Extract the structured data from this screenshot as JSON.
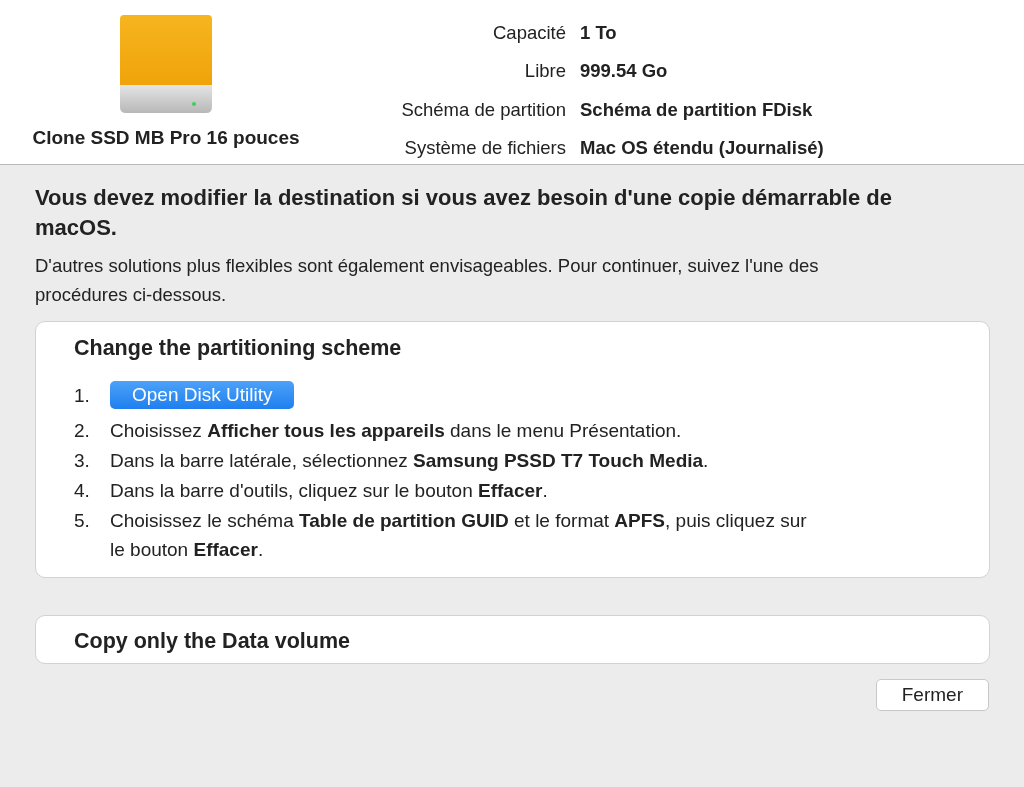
{
  "drive": {
    "name": "Clone SSD MB Pro 16 pouces"
  },
  "info": [
    {
      "label": "Capacité",
      "value": "1 To"
    },
    {
      "label": "Libre",
      "value": "999.54 Go"
    },
    {
      "label": "Schéma de partition",
      "value": "Schéma de partition FDisk"
    },
    {
      "label": "Système de fichiers",
      "value": "Mac OS étendu (Journalisé)"
    }
  ],
  "warning": {
    "title": "Vous devez modifier la destination si vous avez besoin d'une copie démarrable de macOS.",
    "text": "D'autres solutions plus flexibles sont également envisageables. Pour continuer, suivez l'une des procédures ci-dessous."
  },
  "sections": [
    {
      "title": "Change the partitioning scheme",
      "steps": [
        {
          "number": "1.",
          "kind": "button",
          "text": "Open Disk Utility"
        },
        {
          "number": "2.",
          "kind": "text",
          "text": "Choisissez **Afficher tous les appareils** dans le menu Présentation."
        },
        {
          "number": "3.",
          "kind": "text",
          "text": "Dans la barre latérale, sélectionnez **Samsung PSSD T7 Touch Media**."
        },
        {
          "number": "4.",
          "kind": "text",
          "text": "Dans la barre d'outils, cliquez sur le bouton **Effacer**."
        },
        {
          "number": "5.",
          "kind": "text",
          "text": "Choisissez le schéma **Table de partition GUID** et le format **APFS**, puis cliquez sur le bouton **Effacer**."
        }
      ]
    },
    {
      "title": "Copy only the Data volume"
    }
  ],
  "buttons": [
    {
      "label": "Fermer"
    }
  ]
}
